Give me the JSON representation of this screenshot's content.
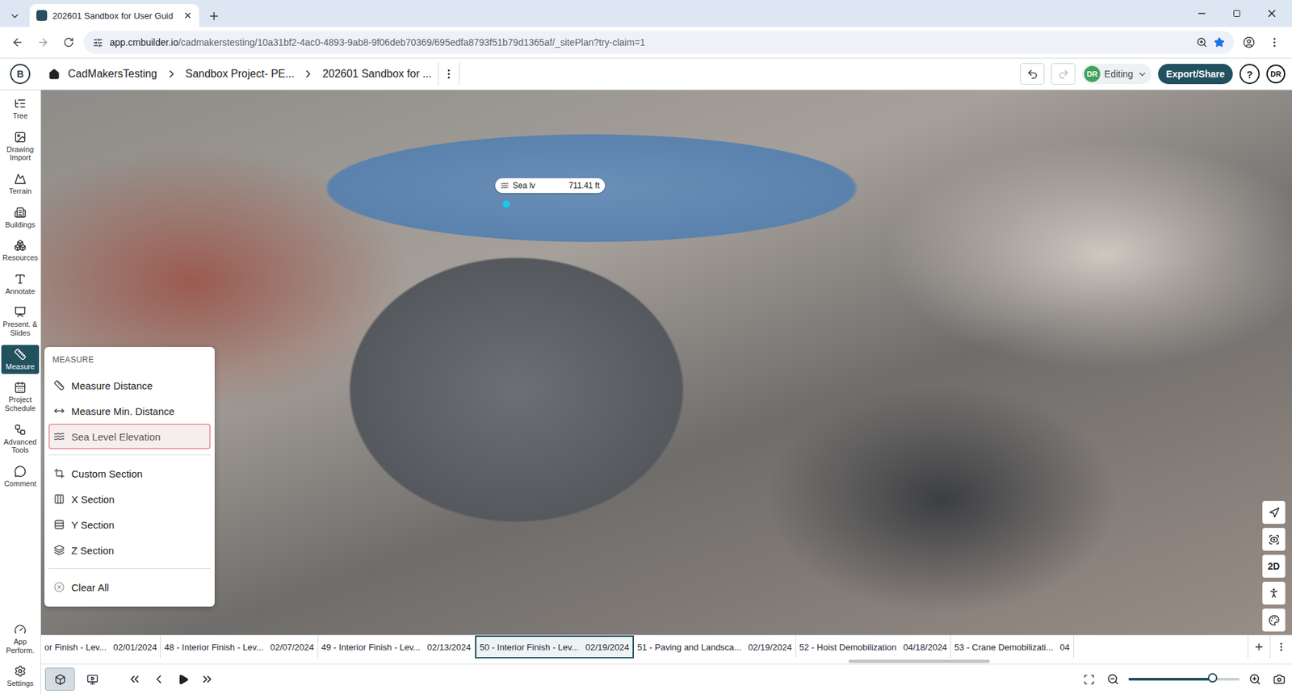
{
  "browser": {
    "tab_title": "202601 Sandbox for User Guid",
    "url_host": "app.cmbuilder.io",
    "url_path": "/cadmakerstesting/10a31bf2-4ac0-4893-9ab8-9f06deb70369/695edfa8793f51b79d1365af/_sitePlan?try-claim=1"
  },
  "header": {
    "logo": "B",
    "breadcrumbs": [
      "CadMakersTesting",
      "Sandbox Project- PE...",
      "202601 Sandbox for ..."
    ],
    "mode": {
      "initials": "DR",
      "label": "Editing"
    },
    "export": "Export/Share",
    "help": "?",
    "avatar": "DR"
  },
  "sidebar": {
    "items": [
      {
        "label": "Tree",
        "selected": false
      },
      {
        "label": "Drawing Import",
        "selected": false
      },
      {
        "label": "Terrain",
        "selected": false
      },
      {
        "label": "Buildings",
        "selected": false
      },
      {
        "label": "Resources",
        "selected": false
      },
      {
        "label": "Annotate",
        "selected": false
      },
      {
        "label": "Present. & Slides",
        "selected": false
      },
      {
        "label": "Measure",
        "selected": true
      },
      {
        "label": "Project Schedule",
        "selected": false
      },
      {
        "label": "Advanced Tools",
        "selected": false
      },
      {
        "label": "Comment",
        "selected": false
      }
    ],
    "bottom": [
      {
        "label": "App Perform.",
        "selected": false
      },
      {
        "label": "Settings",
        "selected": false
      }
    ]
  },
  "viewport": {
    "elevation_label": {
      "name": "Sea lv",
      "value": "711.41 ft"
    },
    "view_toggle": "2D"
  },
  "measure_menu": {
    "title": "MEASURE",
    "groups": [
      [
        {
          "label": "Measure Distance",
          "selected": false
        },
        {
          "label": "Measure Min. Distance",
          "selected": false
        },
        {
          "label": "Sea Level Elevation",
          "selected": true
        }
      ],
      [
        {
          "label": "Custom Section",
          "selected": false
        },
        {
          "label": "X Section",
          "selected": false
        },
        {
          "label": "Y Section",
          "selected": false
        },
        {
          "label": "Z Section",
          "selected": false
        }
      ],
      [
        {
          "label": "Clear All",
          "selected": false
        }
      ]
    ]
  },
  "timeline": {
    "items": [
      {
        "label": "or Finish - Lev...",
        "date": "02/01/2024",
        "selected": false
      },
      {
        "label": "48 - Interior Finish - Lev...",
        "date": "02/07/2024",
        "selected": false
      },
      {
        "label": "49 - Interior Finish - Lev...",
        "date": "02/13/2024",
        "selected": false
      },
      {
        "label": "50 - Interior Finish - Lev...",
        "date": "02/19/2024",
        "selected": true
      },
      {
        "label": "51 - Paving and Landsca...",
        "date": "02/19/2024",
        "selected": false
      },
      {
        "label": "52 - Hoist Demobilization",
        "date": "04/18/2024",
        "selected": false
      },
      {
        "label": "53 - Crane Demobilizati...",
        "date": "04",
        "selected": false
      }
    ]
  },
  "playback": {
    "view_modes": [
      {
        "selected": true
      },
      {
        "selected": false
      }
    ],
    "zoom_level": 0.76
  }
}
